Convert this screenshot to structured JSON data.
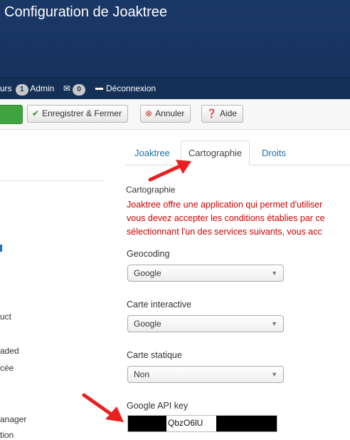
{
  "header": {
    "title": "Configuration de Joaktree"
  },
  "statusbar": {
    "users_label": "urs",
    "admin_count": "1",
    "admin_label": "Admin",
    "messages_count": "0",
    "logout_label": "Déconnexion"
  },
  "toolbar": {
    "save_close_label": "Enregistrer & Fermer",
    "cancel_label": "Annuler",
    "help_label": "Aide"
  },
  "sidebar": {
    "fragments": [
      "uct",
      "aded",
      "cée",
      "anager",
      "tion"
    ]
  },
  "tabs": [
    {
      "label": "Joaktree",
      "active": false
    },
    {
      "label": "Cartographie",
      "active": true
    },
    {
      "label": "Droits",
      "active": false
    }
  ],
  "section": {
    "title": "Cartographie",
    "description_lines": [
      "Joaktree offre une application qui permet d'utiliser",
      "vous devez accepter les conditions établies par ce",
      "sélectionnant l'un des services suivants, vous acc"
    ]
  },
  "fields": {
    "geocoding": {
      "label": "Geocoding",
      "value": "Google"
    },
    "interactive_map": {
      "label": "Carte interactive",
      "value": "Google"
    },
    "static_map": {
      "label": "Carte statique",
      "value": "Non"
    },
    "api_key": {
      "label": "Google API key",
      "visible_value": "QbzO6lU"
    }
  },
  "colors": {
    "header_bg": "#1a3867",
    "statusbar_bg": "#143056",
    "save_green": "#3fa33f",
    "tab_link": "#1a6fa6",
    "description_red": "#cc0000",
    "annotation_arrow": "#e8201f"
  },
  "icons": {
    "save_close": "check-icon",
    "cancel": "cancel-circle-icon",
    "help": "question-circle-icon",
    "messages": "envelope-icon",
    "logout": "minus-icon",
    "caret": "chevron-down-icon"
  }
}
